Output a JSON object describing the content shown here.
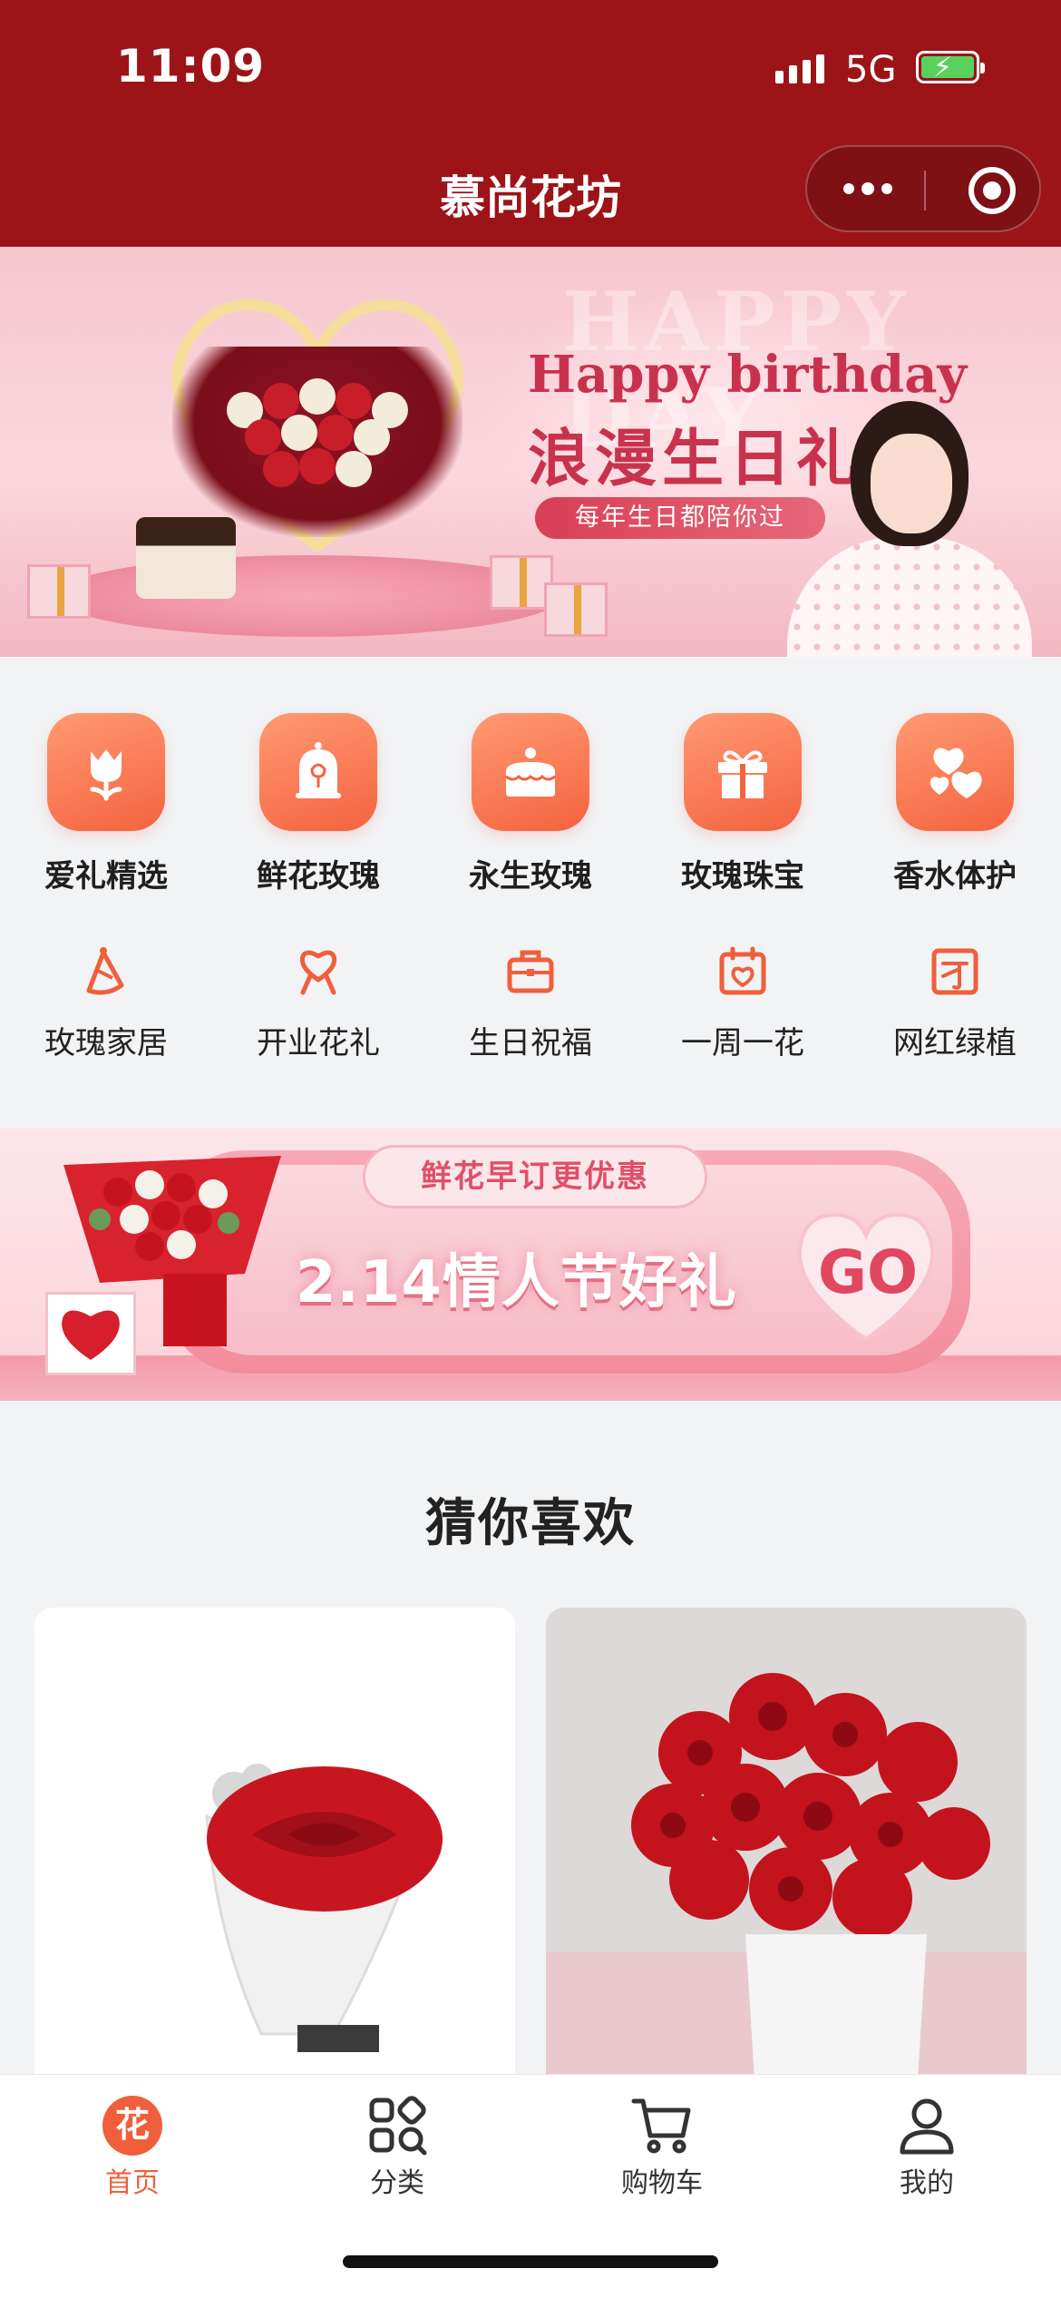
{
  "status_bar": {
    "time": "11:09",
    "network": "5G"
  },
  "nav": {
    "title": "慕尚花坊"
  },
  "hero": {
    "ghost_text": "HAPPY DAY",
    "title_en": "Happy birthday",
    "title_cn": "浪漫生日礼",
    "pill": "每年生日都陪你过"
  },
  "categories_primary": [
    {
      "label": "爱礼精选",
      "icon": "tulip-icon"
    },
    {
      "label": "鲜花玫瑰",
      "icon": "rose-dome-icon"
    },
    {
      "label": "永生玫瑰",
      "icon": "cake-icon"
    },
    {
      "label": "玫瑰珠宝",
      "icon": "gift-icon"
    },
    {
      "label": "香水体护",
      "icon": "hearts-icon"
    }
  ],
  "categories_secondary": [
    {
      "label": "玫瑰家居",
      "icon": "party-hat-icon"
    },
    {
      "label": "开业花礼",
      "icon": "heart-ribbon-icon"
    },
    {
      "label": "生日祝福",
      "icon": "briefcase-icon"
    },
    {
      "label": "一周一花",
      "icon": "calendar-heart-icon"
    },
    {
      "label": "网红绿植",
      "icon": "note-icon"
    }
  ],
  "promo": {
    "tag": "鲜花早订更优惠",
    "headline": "2.14情人节好礼",
    "go": "GO"
  },
  "recommend": {
    "title": "猜你喜欢"
  },
  "tabbar": [
    {
      "label": "首页",
      "icon": "home-flower-icon",
      "active": true,
      "glyph": "花"
    },
    {
      "label": "分类",
      "icon": "category-icon",
      "active": false
    },
    {
      "label": "购物车",
      "icon": "cart-icon",
      "active": false
    },
    {
      "label": "我的",
      "icon": "profile-icon",
      "active": false
    }
  ],
  "colors": {
    "header": "#9c1418",
    "accent": "#ef5f3b"
  }
}
